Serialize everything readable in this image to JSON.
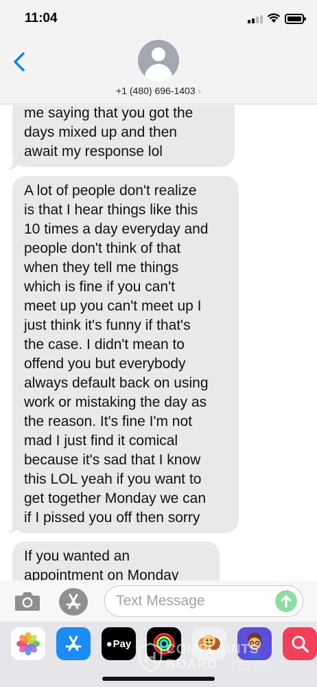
{
  "status_bar": {
    "time": "11:04"
  },
  "header": {
    "contact_number": "+1 (480) 696-1403",
    "chevron": "›"
  },
  "messages": [
    {
      "text": "me saying that you got the\ndays mixed up and then\nawait my response lol"
    },
    {
      "text": "A lot of people don't realize\nis that I hear things like this\n10 times a day everyday and\npeople don't think of that\nwhen they tell me things\nwhich is fine if you can't\nmeet up you can't meet up I\njust think it's funny if that's\nthe case. I didn't mean to\noffend you but everybody\nalways default back on using\nwork or mistaking the day as\nthe reason. It's fine I'm not\nmad I just find it comical\nbecause it's sad that I know\nthis LOL yeah if you want to\nget together Monday we can\nif I pissed you off then sorry"
    },
    {
      "text": "If you wanted an\nappointment on Monday"
    }
  ],
  "input": {
    "placeholder": "Text Message"
  },
  "app_drawer": {
    "apps": [
      {
        "name": "photos-app-icon"
      },
      {
        "name": "app-store-app-icon"
      },
      {
        "name": "apple-pay-app-icon",
        "label": "Pay"
      },
      {
        "name": "activity-app-icon"
      },
      {
        "name": "memoji-stickers-app-icon"
      },
      {
        "name": "memoji-app-icon"
      },
      {
        "name": "web-search-app-icon"
      }
    ]
  },
  "watermark": {
    "line1": "COMPLAINTS",
    "line2": "BOARD",
    "sub1": "RESOLVING",
    "sub2": "SINCE 2004"
  },
  "colors": {
    "ios_blue": "#147efb",
    "bubble_grey": "#e9e9eb",
    "send_green": "#8fdca2"
  }
}
